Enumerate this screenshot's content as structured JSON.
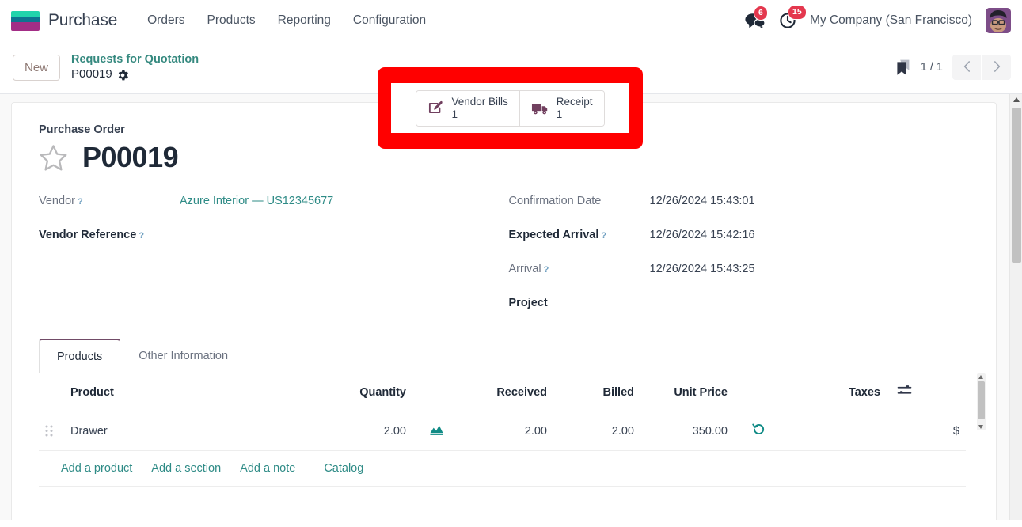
{
  "navbar": {
    "brand": "Purchase",
    "logo_colors": [
      "#21d4ac",
      "#0e7490",
      "#a32d86"
    ],
    "menu": [
      {
        "label": "Orders"
      },
      {
        "label": "Products"
      },
      {
        "label": "Reporting"
      },
      {
        "label": "Configuration"
      }
    ],
    "messages_icon": "chat-bubble-icon",
    "messages_count": "6",
    "activities_icon": "clock-icon",
    "activities_count": "15",
    "company": "My Company (San Francisco)",
    "badge_color": "#e4384e"
  },
  "control_panel": {
    "new_label": "New",
    "breadcrumb_parent": "Requests for Quotation",
    "breadcrumb_current": "P00019",
    "gear_icon": "gear-icon",
    "bookmark_icon": "bookmark-icon",
    "pager": "1 / 1",
    "prev_icon": "chevron-left-icon",
    "next_icon": "chevron-right-icon",
    "highlight_color": "#ff0000",
    "smart_buttons": [
      {
        "icon": "bill-pencil-icon",
        "label": "Vendor Bills",
        "value": "1"
      },
      {
        "icon": "truck-icon",
        "label": "Receipt",
        "value": "1"
      }
    ]
  },
  "form": {
    "title_label": "Purchase Order",
    "star_icon": "star-outline-icon",
    "record_id": "P00019",
    "left_fields": [
      {
        "label": "Vendor",
        "tip": "?",
        "value": "Azure Interior — US12345677",
        "is_link": true,
        "bold": false
      },
      {
        "label": "Vendor Reference",
        "tip": "?",
        "value": "",
        "is_link": false,
        "bold": true
      }
    ],
    "right_fields": [
      {
        "label": "Confirmation Date",
        "tip": "",
        "value": "12/26/2024 15:43:01",
        "bold": false
      },
      {
        "label": "Expected Arrival",
        "tip": "?",
        "value": "12/26/2024 15:42:16",
        "bold": true
      },
      {
        "label": "Arrival",
        "tip": "?",
        "value": "12/26/2024 15:43:25",
        "bold": false
      },
      {
        "label": "Project",
        "tip": "",
        "value": "",
        "bold": true
      }
    ]
  },
  "notebook": {
    "tabs": [
      {
        "label": "Products",
        "active": true
      },
      {
        "label": "Other Information",
        "active": false
      }
    ],
    "columns": {
      "product": "Product",
      "quantity": "Quantity",
      "received": "Received",
      "billed": "Billed",
      "unit_price": "Unit Price",
      "taxes": "Taxes",
      "optional_icon": "column-settings-icon"
    },
    "rows": [
      {
        "drag_icon": "drag-handle-icon",
        "product": "Drawer",
        "quantity": "2.00",
        "quantity_icon": "forecast-chart-icon",
        "received": "2.00",
        "billed": "2.00",
        "unit_price": "350.00",
        "unit_price_icon": "price-history-icon",
        "taxes": "",
        "subtotal_currency": "$"
      }
    ],
    "add_links": [
      {
        "label": "Add a product"
      },
      {
        "label": "Add a section"
      },
      {
        "label": "Add a note"
      },
      {
        "label": "Catalog"
      }
    ]
  }
}
